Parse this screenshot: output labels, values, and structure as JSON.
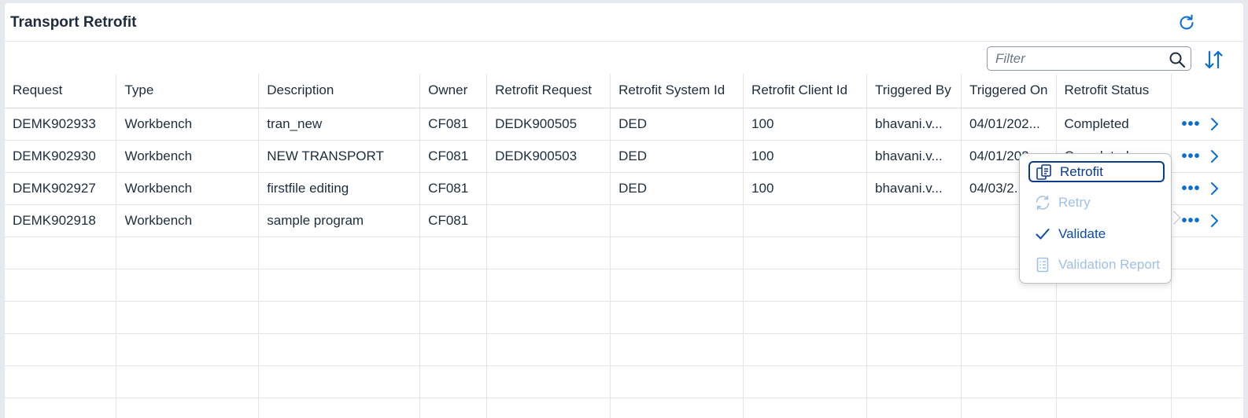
{
  "header": {
    "title": "Transport Retrofit"
  },
  "toolbar": {
    "filter_placeholder": "Filter",
    "filter_value": ""
  },
  "table": {
    "columns": [
      "Request",
      "Type",
      "Description",
      "Owner",
      "Retrofit Request",
      "Retrofit System Id",
      "Retrofit Client Id",
      "Triggered By",
      "Triggered On",
      "Retrofit Status"
    ],
    "rows": [
      [
        "DEMK902933",
        "Workbench",
        "tran_new",
        "CF081",
        "DEDK900505",
        "DED",
        "100",
        "bhavani.v...",
        "04/01/202...",
        "Completed"
      ],
      [
        "DEMK902930",
        "Workbench",
        "NEW TRANSPORT",
        "CF081",
        "DEDK900503",
        "DED",
        "100",
        "bhavani.v...",
        "04/01/202...",
        "Completed"
      ],
      [
        "DEMK902927",
        "Workbench",
        "firstfile editing",
        "CF081",
        "",
        "DED",
        "100",
        "bhavani.v...",
        "04/03/2...",
        ""
      ],
      [
        "DEMK902918",
        "Workbench",
        "sample program",
        "CF081",
        "",
        "",
        "",
        "",
        "",
        ""
      ]
    ],
    "more_glyph": "•••"
  },
  "menu": {
    "items": [
      {
        "label": "Retrofit",
        "icon": "copy-icon",
        "state": "focused"
      },
      {
        "label": "Retry",
        "icon": "refresh-icon",
        "state": "disabled"
      },
      {
        "label": "Validate",
        "icon": "checkmark-icon",
        "state": "enabled"
      },
      {
        "label": "Validation Report",
        "icon": "report-icon",
        "state": "disabled"
      }
    ]
  },
  "colors": {
    "accent": "#0a6ed1",
    "success": "#256f3a",
    "text": "#1d2d3e",
    "disabled": "#9fc1e6"
  }
}
